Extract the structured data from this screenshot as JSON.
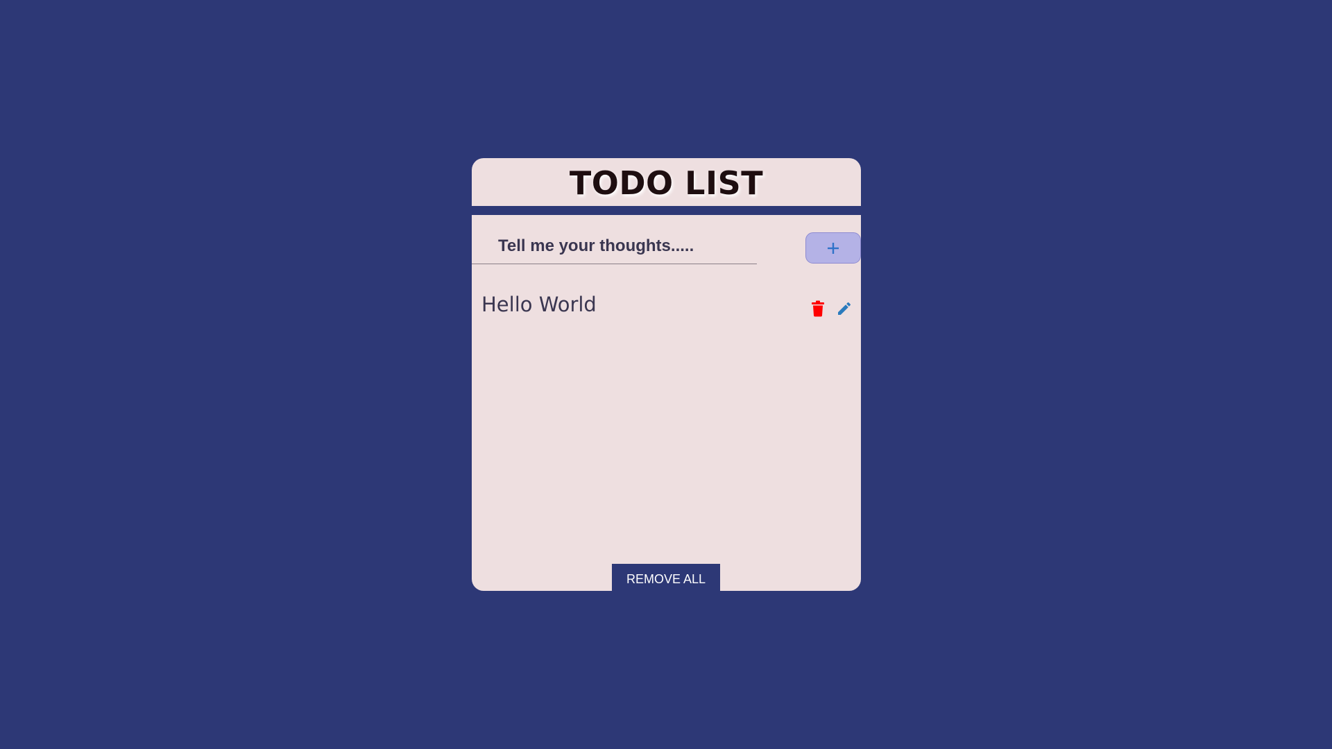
{
  "header": {
    "title": "TODO LIST"
  },
  "form": {
    "placeholder": "Tell me your thoughts.....",
    "value": "",
    "add_icon": "plus-icon"
  },
  "todos": [
    {
      "text": "Hello World",
      "delete_icon": "trash-icon",
      "edit_icon": "pencil-icon"
    }
  ],
  "footer": {
    "remove_all_label": "REMOVE ALL"
  },
  "colors": {
    "page_background": "#2d3876",
    "card_background": "#eedfe0",
    "add_button": "#b4b2e6",
    "plus_icon": "#2f72c9",
    "delete_icon": "#ff0000",
    "edit_icon": "#2b7bbd"
  }
}
